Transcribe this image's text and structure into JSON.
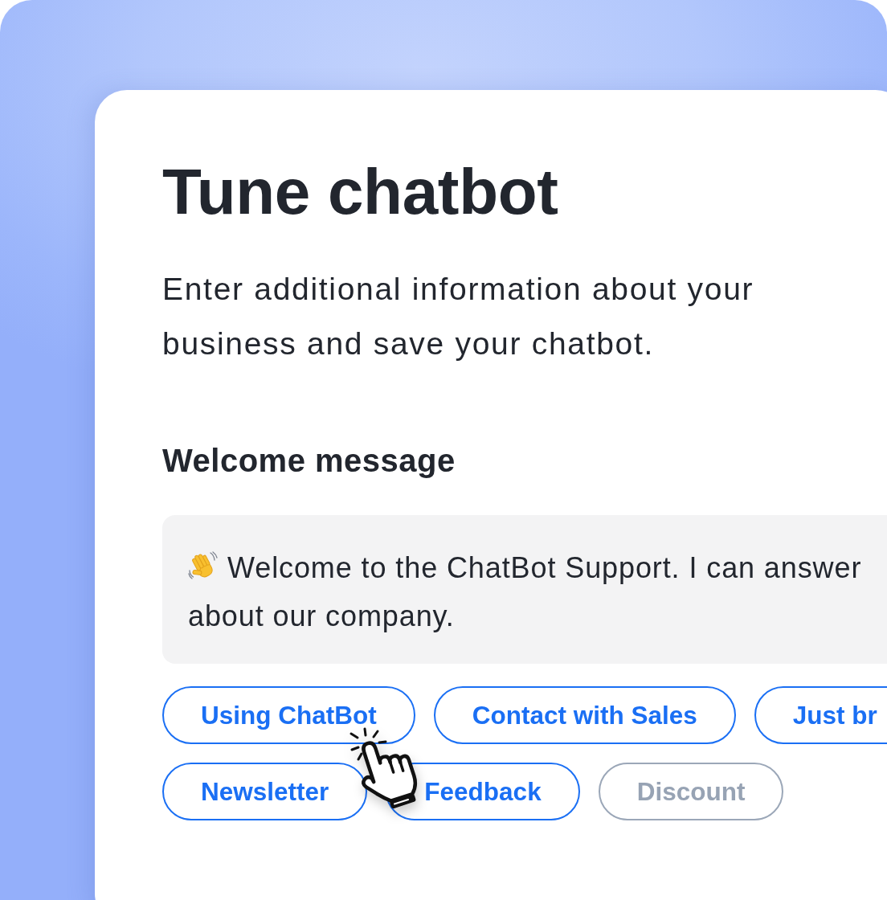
{
  "heading": {
    "title": "Tune chatbot",
    "subtitle": "Enter additional information about your business and save your chatbot."
  },
  "welcome_message": {
    "label": "Welcome message",
    "lines": [
      "Welcome to the ChatBot Support. I can answer",
      "about our company."
    ]
  },
  "quick_replies": [
    [
      {
        "label": "Using ChatBot",
        "disabled": false
      },
      {
        "label": "Contact with Sales",
        "disabled": false
      },
      {
        "label": "Just br",
        "disabled": false
      }
    ],
    [
      {
        "label": "Newsletter",
        "disabled": false
      },
      {
        "label": "Feedback",
        "disabled": false
      },
      {
        "label": "Discount",
        "disabled": true
      }
    ]
  ]
}
